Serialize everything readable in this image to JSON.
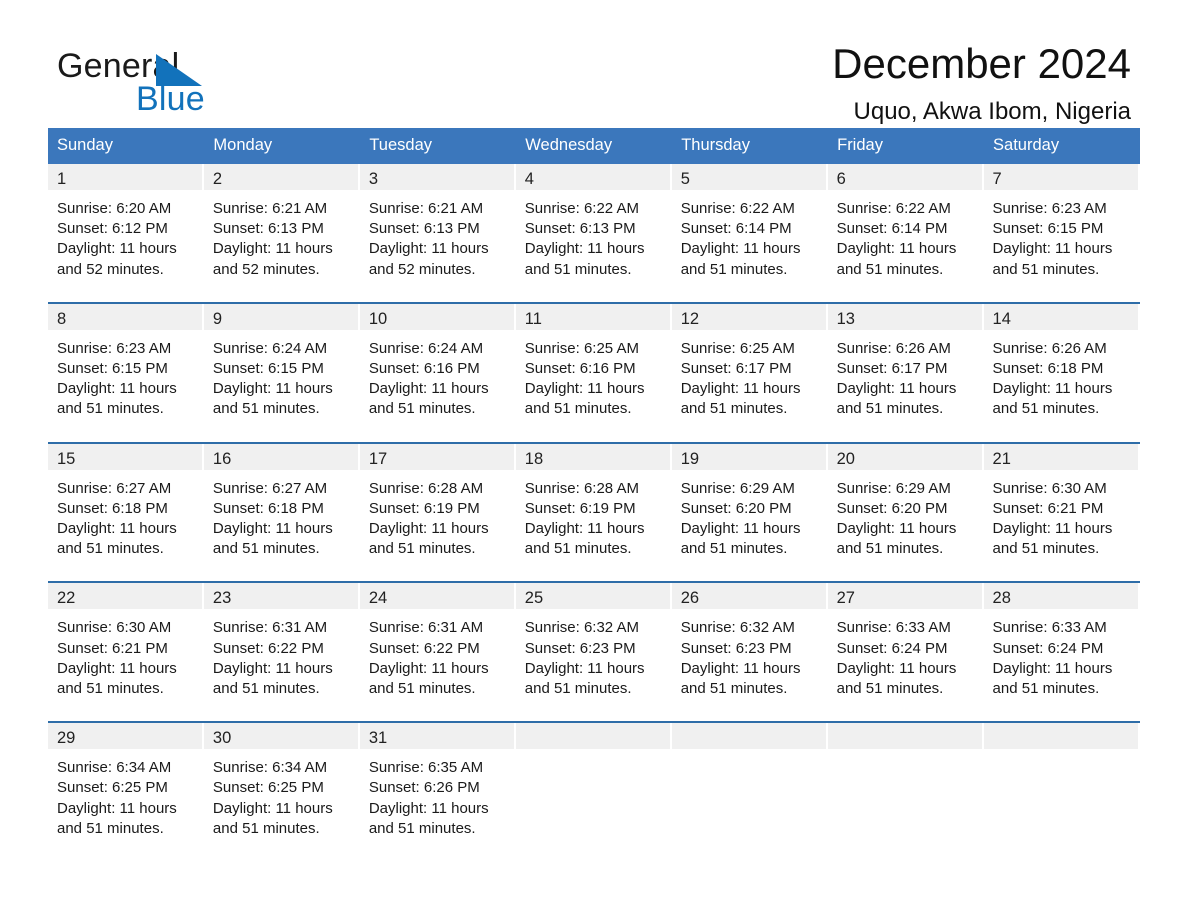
{
  "brand": {
    "name_part1": "General",
    "name_part2": "Blue",
    "logo_icon": "triangle-logo-icon"
  },
  "header": {
    "title": "December 2024",
    "subtitle": "Uquo, Akwa Ibom, Nigeria",
    "accent_color": "#3b77bc",
    "separator_color": "#2e6da8",
    "daynum_band_color": "#f0f0f0"
  },
  "weekday_headers": [
    "Sunday",
    "Monday",
    "Tuesday",
    "Wednesday",
    "Thursday",
    "Friday",
    "Saturday"
  ],
  "calendar": {
    "weeks": [
      [
        {
          "day": "1",
          "sunrise": "Sunrise: 6:20 AM",
          "sunset": "Sunset: 6:12 PM",
          "daylight": "Daylight: 11 hours and 52 minutes."
        },
        {
          "day": "2",
          "sunrise": "Sunrise: 6:21 AM",
          "sunset": "Sunset: 6:13 PM",
          "daylight": "Daylight: 11 hours and 52 minutes."
        },
        {
          "day": "3",
          "sunrise": "Sunrise: 6:21 AM",
          "sunset": "Sunset: 6:13 PM",
          "daylight": "Daylight: 11 hours and 52 minutes."
        },
        {
          "day": "4",
          "sunrise": "Sunrise: 6:22 AM",
          "sunset": "Sunset: 6:13 PM",
          "daylight": "Daylight: 11 hours and 51 minutes."
        },
        {
          "day": "5",
          "sunrise": "Sunrise: 6:22 AM",
          "sunset": "Sunset: 6:14 PM",
          "daylight": "Daylight: 11 hours and 51 minutes."
        },
        {
          "day": "6",
          "sunrise": "Sunrise: 6:22 AM",
          "sunset": "Sunset: 6:14 PM",
          "daylight": "Daylight: 11 hours and 51 minutes."
        },
        {
          "day": "7",
          "sunrise": "Sunrise: 6:23 AM",
          "sunset": "Sunset: 6:15 PM",
          "daylight": "Daylight: 11 hours and 51 minutes."
        }
      ],
      [
        {
          "day": "8",
          "sunrise": "Sunrise: 6:23 AM",
          "sunset": "Sunset: 6:15 PM",
          "daylight": "Daylight: 11 hours and 51 minutes."
        },
        {
          "day": "9",
          "sunrise": "Sunrise: 6:24 AM",
          "sunset": "Sunset: 6:15 PM",
          "daylight": "Daylight: 11 hours and 51 minutes."
        },
        {
          "day": "10",
          "sunrise": "Sunrise: 6:24 AM",
          "sunset": "Sunset: 6:16 PM",
          "daylight": "Daylight: 11 hours and 51 minutes."
        },
        {
          "day": "11",
          "sunrise": "Sunrise: 6:25 AM",
          "sunset": "Sunset: 6:16 PM",
          "daylight": "Daylight: 11 hours and 51 minutes."
        },
        {
          "day": "12",
          "sunrise": "Sunrise: 6:25 AM",
          "sunset": "Sunset: 6:17 PM",
          "daylight": "Daylight: 11 hours and 51 minutes."
        },
        {
          "day": "13",
          "sunrise": "Sunrise: 6:26 AM",
          "sunset": "Sunset: 6:17 PM",
          "daylight": "Daylight: 11 hours and 51 minutes."
        },
        {
          "day": "14",
          "sunrise": "Sunrise: 6:26 AM",
          "sunset": "Sunset: 6:18 PM",
          "daylight": "Daylight: 11 hours and 51 minutes."
        }
      ],
      [
        {
          "day": "15",
          "sunrise": "Sunrise: 6:27 AM",
          "sunset": "Sunset: 6:18 PM",
          "daylight": "Daylight: 11 hours and 51 minutes."
        },
        {
          "day": "16",
          "sunrise": "Sunrise: 6:27 AM",
          "sunset": "Sunset: 6:18 PM",
          "daylight": "Daylight: 11 hours and 51 minutes."
        },
        {
          "day": "17",
          "sunrise": "Sunrise: 6:28 AM",
          "sunset": "Sunset: 6:19 PM",
          "daylight": "Daylight: 11 hours and 51 minutes."
        },
        {
          "day": "18",
          "sunrise": "Sunrise: 6:28 AM",
          "sunset": "Sunset: 6:19 PM",
          "daylight": "Daylight: 11 hours and 51 minutes."
        },
        {
          "day": "19",
          "sunrise": "Sunrise: 6:29 AM",
          "sunset": "Sunset: 6:20 PM",
          "daylight": "Daylight: 11 hours and 51 minutes."
        },
        {
          "day": "20",
          "sunrise": "Sunrise: 6:29 AM",
          "sunset": "Sunset: 6:20 PM",
          "daylight": "Daylight: 11 hours and 51 minutes."
        },
        {
          "day": "21",
          "sunrise": "Sunrise: 6:30 AM",
          "sunset": "Sunset: 6:21 PM",
          "daylight": "Daylight: 11 hours and 51 minutes."
        }
      ],
      [
        {
          "day": "22",
          "sunrise": "Sunrise: 6:30 AM",
          "sunset": "Sunset: 6:21 PM",
          "daylight": "Daylight: 11 hours and 51 minutes."
        },
        {
          "day": "23",
          "sunrise": "Sunrise: 6:31 AM",
          "sunset": "Sunset: 6:22 PM",
          "daylight": "Daylight: 11 hours and 51 minutes."
        },
        {
          "day": "24",
          "sunrise": "Sunrise: 6:31 AM",
          "sunset": "Sunset: 6:22 PM",
          "daylight": "Daylight: 11 hours and 51 minutes."
        },
        {
          "day": "25",
          "sunrise": "Sunrise: 6:32 AM",
          "sunset": "Sunset: 6:23 PM",
          "daylight": "Daylight: 11 hours and 51 minutes."
        },
        {
          "day": "26",
          "sunrise": "Sunrise: 6:32 AM",
          "sunset": "Sunset: 6:23 PM",
          "daylight": "Daylight: 11 hours and 51 minutes."
        },
        {
          "day": "27",
          "sunrise": "Sunrise: 6:33 AM",
          "sunset": "Sunset: 6:24 PM",
          "daylight": "Daylight: 11 hours and 51 minutes."
        },
        {
          "day": "28",
          "sunrise": "Sunrise: 6:33 AM",
          "sunset": "Sunset: 6:24 PM",
          "daylight": "Daylight: 11 hours and 51 minutes."
        }
      ],
      [
        {
          "day": "29",
          "sunrise": "Sunrise: 6:34 AM",
          "sunset": "Sunset: 6:25 PM",
          "daylight": "Daylight: 11 hours and 51 minutes."
        },
        {
          "day": "30",
          "sunrise": "Sunrise: 6:34 AM",
          "sunset": "Sunset: 6:25 PM",
          "daylight": "Daylight: 11 hours and 51 minutes."
        },
        {
          "day": "31",
          "sunrise": "Sunrise: 6:35 AM",
          "sunset": "Sunset: 6:26 PM",
          "daylight": "Daylight: 11 hours and 51 minutes."
        },
        {
          "day": "",
          "sunrise": "",
          "sunset": "",
          "daylight": ""
        },
        {
          "day": "",
          "sunrise": "",
          "sunset": "",
          "daylight": ""
        },
        {
          "day": "",
          "sunrise": "",
          "sunset": "",
          "daylight": ""
        },
        {
          "day": "",
          "sunrise": "",
          "sunset": "",
          "daylight": ""
        }
      ]
    ]
  }
}
